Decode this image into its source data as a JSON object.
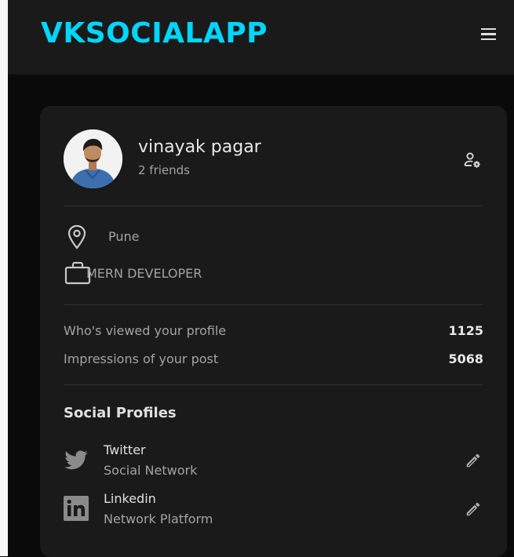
{
  "navbar": {
    "brand": "VKSOCIALAPP",
    "menu_icon": "hamburger-menu-icon"
  },
  "profile": {
    "name": "vinayak pagar",
    "friends": "2 friends",
    "location": "Pune",
    "occupation": "MERN DEVELOPER",
    "stats": [
      {
        "label": "Who's viewed your profile",
        "value": "1125"
      },
      {
        "label": "Impressions of your post",
        "value": "5068"
      }
    ],
    "social_title": "Social Profiles",
    "socials": [
      {
        "name": "Twitter",
        "subtitle": "Social Network",
        "icon": "twitter-icon"
      },
      {
        "name": "Linkedin",
        "subtitle": "Network Platform",
        "icon": "linkedin-icon"
      }
    ]
  },
  "colors": {
    "accent": "#00d5fa",
    "card": "#1a1a1a",
    "background": "#0a0a0a"
  }
}
